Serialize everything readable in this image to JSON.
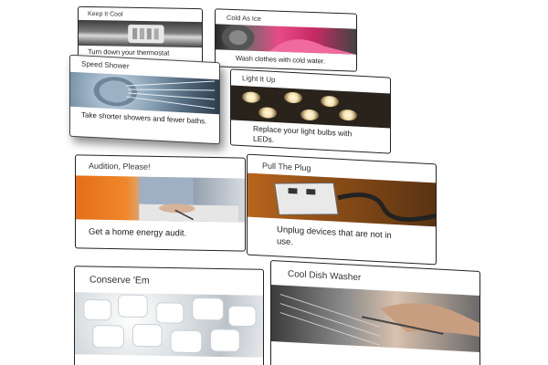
{
  "cards": [
    {
      "title": "Keep It Cool",
      "text": "Turn down your thermostat",
      "image_icon": "thermostat-image"
    },
    {
      "title": "Cold As Ice",
      "text": "Wash clothes with cold water.",
      "image_icon": "laundry-image"
    },
    {
      "title": "Speed Shower",
      "text": "Take shorter showers and fewer baths.",
      "image_icon": "shower-head-image"
    },
    {
      "title": "Light It Up",
      "text": "Replace your light bulbs with LEDs.",
      "image_icon": "light-bulbs-image"
    },
    {
      "title": "Audition, Please!",
      "text": "Get a home energy audit.",
      "image_icon": "energy-audit-image"
    },
    {
      "title": "Pull The Plug",
      "text": "Unplug devices that are not in use.",
      "image_icon": "plug-image"
    },
    {
      "title": "Conserve 'Em",
      "text": "",
      "image_icon": "ice-cubes-image"
    },
    {
      "title": "Cool Dish Washer",
      "text": "",
      "image_icon": "dish-washer-image"
    }
  ],
  "colors": {
    "card_border": "#222222",
    "title_text": "#333333",
    "body_text": "#222222",
    "orange_accent": "#e56f1a"
  }
}
